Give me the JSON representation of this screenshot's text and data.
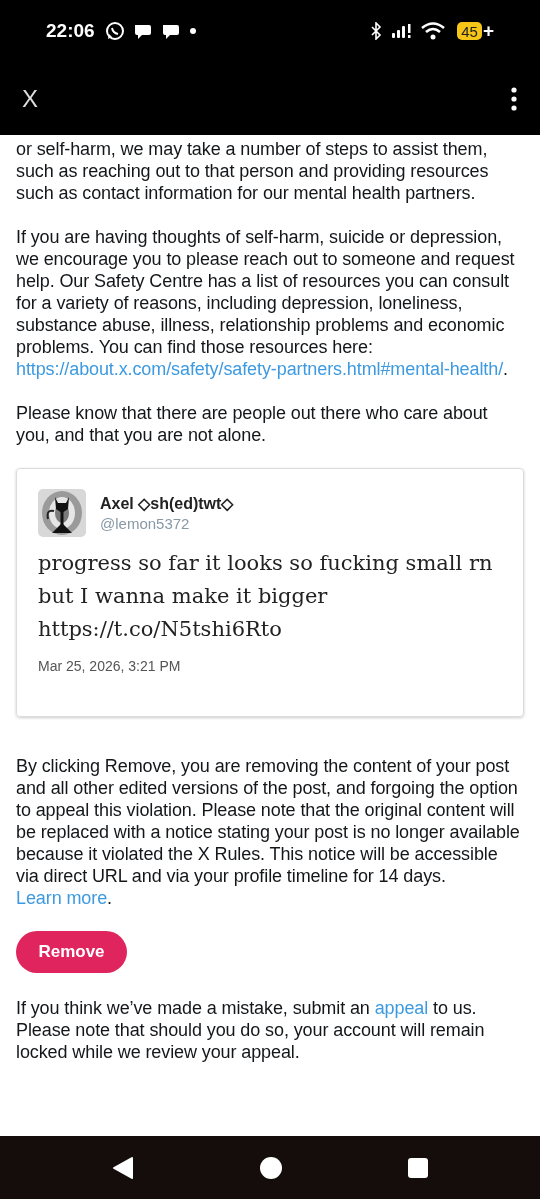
{
  "status_bar": {
    "time": "22:06",
    "battery": "45",
    "battery_suffix": "+"
  },
  "app_bar": {
    "title": "X"
  },
  "body_before": [
    [
      {
        "kind": "text",
        "text": "or self-harm, we may take a number of steps to assist them, such as reaching out to that person and providing resources such as contact information for our mental health partners."
      }
    ],
    [
      {
        "kind": "text",
        "text": "If you are having thoughts of self-harm, suicide or depression, we encourage you to please reach out to someone and request help. Our Safety Centre has a list of resources you can consult for a variety of reasons, including depression, loneliness, substance abuse, illness, relationship problems and economic problems. You can find those resources here: "
      },
      {
        "kind": "link",
        "text": "https://about.x.com/safety/safety-partners.html#mental-health/"
      },
      {
        "kind": "text",
        "text": "."
      }
    ],
    [
      {
        "kind": "text",
        "text": "Please know that there are people out there who care about you, and that you are not alone."
      }
    ]
  ],
  "post": {
    "name": "Axel ◇sh(ed)twt◇",
    "handle": "@lemon5372",
    "text": "progress so far it looks so fucking small rn but I wanna make it bigger https://t.co/N5tshi6Rto",
    "timestamp": "Mar 25, 2026, 3:21 PM"
  },
  "body_after": [
    [
      {
        "kind": "text",
        "text": "By clicking Remove, you are removing the content of your post and all other edited versions of the post, and forgoing the option to appeal this violation. Please note that the original content will be replaced with a notice stating your post is no longer available because it violated the X Rules. This notice will be accessible via direct URL and via your profile timeline for 14 days. "
      },
      {
        "kind": "link",
        "text": "Learn more"
      },
      {
        "kind": "text",
        "text": "."
      }
    ]
  ],
  "remove_button": "Remove",
  "footer": [
    [
      {
        "kind": "text",
        "text": "If you think we’ve made a mistake, submit an "
      },
      {
        "kind": "link",
        "text": "appeal"
      },
      {
        "kind": "text",
        "text": " to us. Please note that should you do so, your account will remain locked while we review your appeal."
      }
    ]
  ]
}
